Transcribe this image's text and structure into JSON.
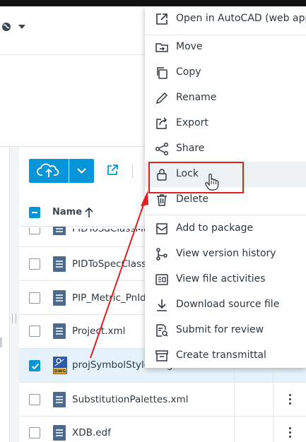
{
  "toolbar": {
    "upload_icon": "cloud-upload-icon",
    "dropdown_icon": "chevron-down-icon",
    "open_external_icon": "open-external-icon"
  },
  "table": {
    "name_header": "Name",
    "sort": "ascending",
    "rows": [
      {
        "name": "PIDToSdClassMa",
        "checked": false,
        "icon": "document-icon"
      },
      {
        "name": "PIDToSpecClass",
        "checked": false,
        "icon": "document-icon"
      },
      {
        "name": "PIP_Metric_PnId",
        "checked": false,
        "icon": "document-icon"
      },
      {
        "name": "Project.xml",
        "checked": false,
        "icon": "document-icon"
      },
      {
        "name": "projSymbolStyle.dwg",
        "checked": true,
        "icon": "dwg-file-icon",
        "badge": "DWG"
      },
      {
        "name": "SubstitutionPalettes.xml",
        "checked": false,
        "icon": "document-icon"
      },
      {
        "name": "XDB.edf",
        "checked": false,
        "icon": "document-icon"
      }
    ]
  },
  "context_menu": {
    "items": [
      {
        "label": "Open in AutoCAD (web app)",
        "icon": "open-external-icon"
      },
      {
        "label": "Move",
        "icon": "move-icon"
      },
      {
        "label": "Copy",
        "icon": "copy-icon"
      },
      {
        "label": "Rename",
        "icon": "pencil-icon"
      },
      {
        "label": "Export",
        "icon": "export-icon"
      },
      {
        "label": "Share",
        "icon": "share-icon"
      },
      {
        "label": "Lock",
        "icon": "lock-icon"
      },
      {
        "label": "Delete",
        "icon": "trash-icon"
      },
      {
        "label": "Add to package",
        "icon": "package-icon"
      },
      {
        "label": "View version history",
        "icon": "version-history-icon"
      },
      {
        "label": "View file activities",
        "icon": "activities-icon"
      },
      {
        "label": "Download source file",
        "icon": "download-icon"
      },
      {
        "label": "Submit for review",
        "icon": "review-icon"
      },
      {
        "label": "Create transmittal",
        "icon": "transmittal-icon"
      }
    ]
  },
  "colors": {
    "accent": "#0696d7",
    "annotation_red": "#e02020"
  }
}
